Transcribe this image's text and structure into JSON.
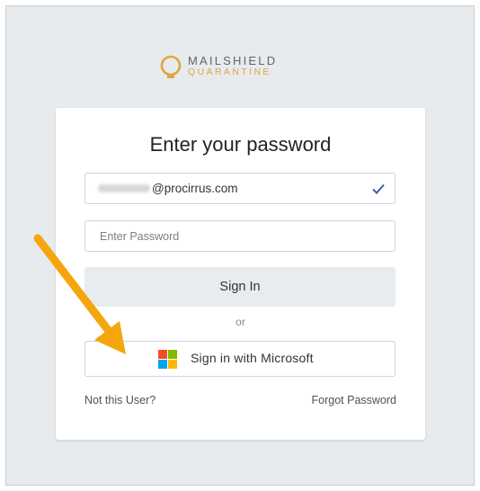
{
  "brand": {
    "line1": "MAILSHIELD",
    "line2": "QUARANTINE",
    "accent": "#e0a441"
  },
  "form": {
    "title": "Enter your password",
    "email_domain": "@procirrus.com",
    "password_placeholder": "Enter Password",
    "signin_label": "Sign In",
    "or_label": "or",
    "microsoft_label": "Sign in with Microsoft",
    "not_user": "Not this User?",
    "forgot": "Forgot Password"
  },
  "icons": {
    "email_valid": "check-icon",
    "microsoft": "microsoft-logo-icon",
    "annotation": "arrow-icon"
  },
  "colors": {
    "arrow": "#f4a60c",
    "check": "#3b5ea8"
  }
}
